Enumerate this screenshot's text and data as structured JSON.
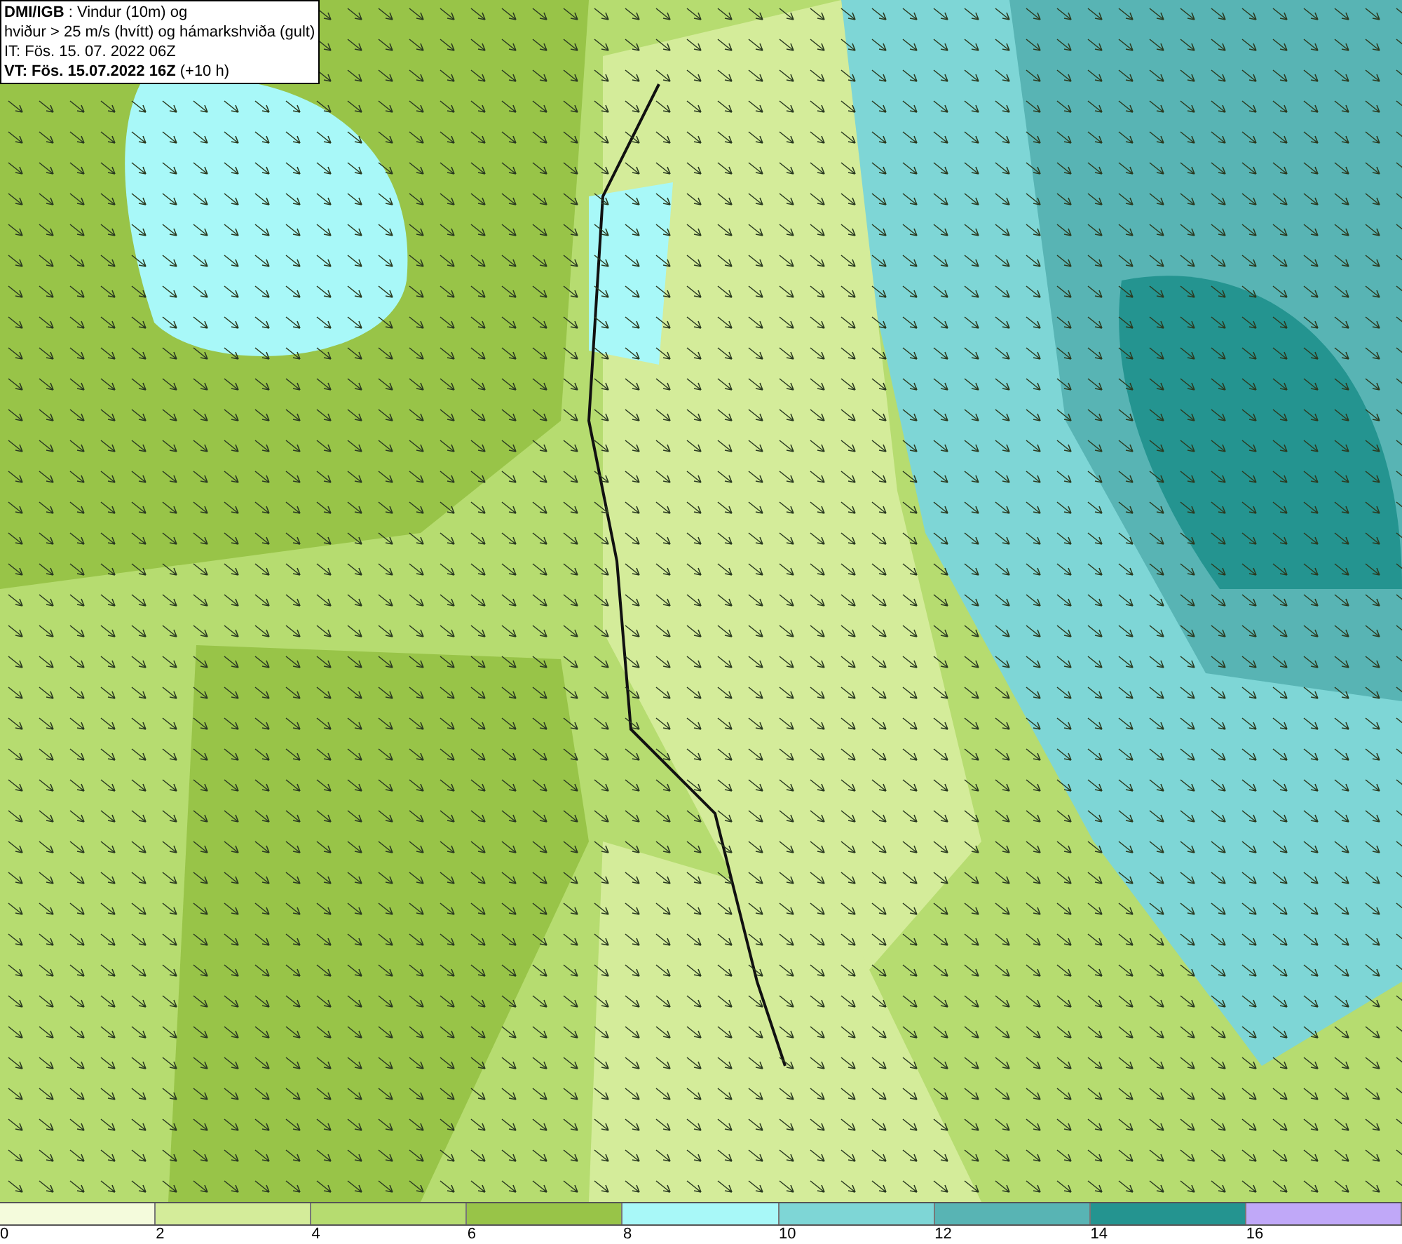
{
  "header": {
    "lines": [
      "**DMI/IGB** : Vindur (10m) og",
      "hviður > 25 m/s (hvítt) og hámarkshviða (gult)",
      "IT: Fös. 15. 07. 2022 06Z",
      "**VT: Fös. 15.07.2022 16Z** (+10 h)"
    ]
  },
  "legend": {
    "bins": [
      {
        "color": "#f4fbdc"
      },
      {
        "color": "#d4ec9a"
      },
      {
        "color": "#b6dc70"
      },
      {
        "color": "#98c448"
      },
      {
        "color": "#a8f8f8"
      },
      {
        "color": "#7ed6d6"
      },
      {
        "color": "#58b4b4"
      },
      {
        "color": "#249490"
      },
      {
        "color": "#c0a8f8"
      }
    ],
    "labels": [
      "0",
      "2",
      "4",
      "6",
      "8",
      "10",
      "12",
      "14",
      "16"
    ]
  }
}
